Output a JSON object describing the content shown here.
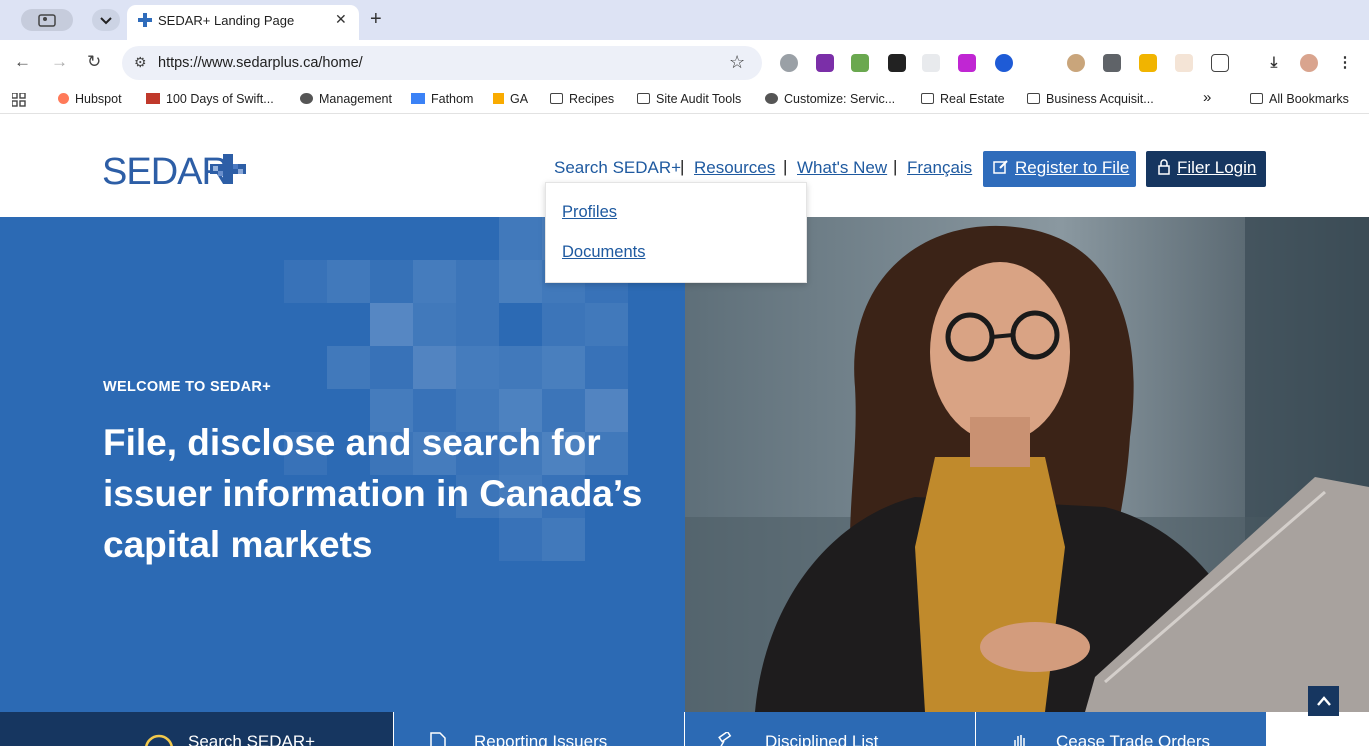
{
  "browser": {
    "tab_title": "SEDAR+ Landing Page",
    "url": "https://www.sedarplus.ca/home/",
    "bookmarks": [
      {
        "label": "Hubspot",
        "kind": "site"
      },
      {
        "label": "100 Days of Swift...",
        "kind": "site"
      },
      {
        "label": "Management",
        "kind": "globe"
      },
      {
        "label": "Fathom",
        "kind": "site"
      },
      {
        "label": "GA",
        "kind": "site"
      },
      {
        "label": "Recipes",
        "kind": "folder"
      },
      {
        "label": "Site Audit Tools",
        "kind": "folder"
      },
      {
        "label": "Customize: Servic...",
        "kind": "globe"
      },
      {
        "label": "Real Estate",
        "kind": "folder"
      },
      {
        "label": "Business Acquisit...",
        "kind": "folder"
      }
    ],
    "all_bookmarks": "All Bookmarks",
    "overflow": "»"
  },
  "header": {
    "logo_text": "SEDAR",
    "nav": {
      "search": "Search SEDAR+",
      "resources": "Resources",
      "whats_new": "What's New",
      "francais": "Français"
    },
    "register_label": "Register to File",
    "login_label": "Filer Login"
  },
  "dropdown": {
    "items": [
      "Profiles",
      "Documents"
    ]
  },
  "hero": {
    "kicker": "WELCOME TO SEDAR+",
    "headline": "File, disclose and search for issuer information in Canada’s capital markets"
  },
  "bottom_tabs": [
    {
      "label": "Search SEDAR+",
      "icon": "search-icon"
    },
    {
      "label": "Reporting Issuers",
      "icon": "document-icon"
    },
    {
      "label": "Disciplined List",
      "icon": "gavel-icon"
    },
    {
      "label": "Cease Trade Orders",
      "icon": "hand-stop-icon"
    }
  ],
  "colors": {
    "brand_blue": "#2c6ab4",
    "dark_navy": "#163660",
    "link_blue": "#1f5aa0",
    "button_blue": "#2f6cbb"
  }
}
